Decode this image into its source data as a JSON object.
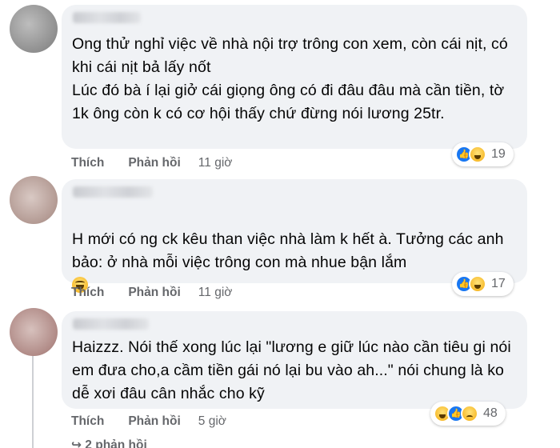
{
  "comments": [
    {
      "text": "Ong thử nghỉ việc về nhà nội trợ trông con xem, còn cái nịt, có khi cái nịt bả lấy nốt\nLúc đó bà í lại giở cái giọng ông có đi đâu đâu mà cần tiền, tờ 1k ông còn k có cơ hội thấy chứ đừng nói lương 25tr.",
      "reaction_count": "19",
      "like_label": "Thích",
      "reply_label": "Phản hồi",
      "time": "11 giờ"
    },
    {
      "text": "H mới có ng ck kêu than việc nhà làm k hết à. Tưởng các anh bảo: ở nhà mỗi việc trông con mà nhue bận lắm",
      "reaction_count": "17",
      "like_label": "Thích",
      "reply_label": "Phản hồi",
      "time": "11 giờ"
    },
    {
      "text": "Haizzz. Nói thế xong lúc lại \"lương e giữ lúc nào cần tiêu gi nói em đưa cho,a cầm tiền gái nó lại bu vào ah...\" nói chung là ko dễ xơi đâu cân nhắc cho kỹ",
      "reaction_count": "48",
      "like_label": "Thích",
      "reply_label": "Phản hồi",
      "time": "5 giờ"
    }
  ],
  "more_replies": "2 phản hồi",
  "icons": [
    "like-reaction-icon",
    "haha-reaction-icon",
    "sad-reaction-icon",
    "laughing-emoji-icon"
  ],
  "colors": {
    "bubble": "#f0f2f5",
    "meta_text": "#65676b",
    "like_blue": "#1877f2",
    "haha_yellow": "#f7b928"
  }
}
